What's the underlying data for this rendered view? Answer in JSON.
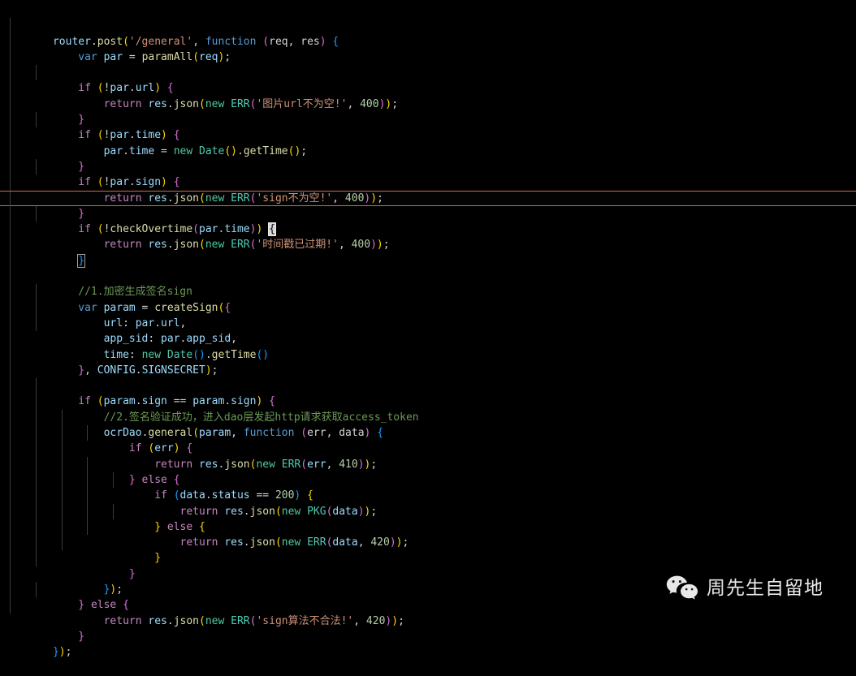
{
  "editor": {
    "language": "javascript",
    "theme": "dark-plus",
    "background": "#000000",
    "current_line_border_color": "#c8704a",
    "indent_guide_color": "#3b3b3b",
    "cursor_line_index": 12,
    "cursor_column_text": "{",
    "matching_bracket_text": "}",
    "matching_bracket_line_index": 14,
    "colors": {
      "keyword": "#c586c0",
      "keyword_blue": "#569cd6",
      "variable": "#9cdcfe",
      "function": "#dcdcaa",
      "type": "#4ec9b0",
      "string": "#ce9178",
      "number": "#b5cea8",
      "comment": "#6a9955",
      "plain": "#d4d4d4",
      "bracket_1": "#ffd700",
      "bracket_2": "#da70d6",
      "bracket_3": "#179fff"
    }
  },
  "code": {
    "lines": [
      "router.post('/general', function (req, res) {",
      "    var par = paramAll(req);",
      "",
      "    if (!par.url) {",
      "        return res.json(new ERR('图片url不为空!', 400));",
      "    }",
      "    if (!par.time) {",
      "        par.time = new Date().getTime();",
      "    }",
      "    if (!par.sign) {",
      "        return res.json(new ERR('sign不为空!', 400));",
      "    }",
      "    if (!checkOvertime(par.time)) {",
      "        return res.json(new ERR('时间戳已过期!', 400));",
      "    }",
      "",
      "    //1.加密生成签名sign",
      "    var param = createSign({",
      "        url: par.url,",
      "        app_sid: par.app_sid,",
      "        time: new Date().getTime()",
      "    }, CONFIG.SIGNSECRET);",
      "",
      "    if (param.sign == param.sign) {",
      "        //2.签名验证成功，进入dao层发起http请求获取access_token",
      "        ocrDao.general(param, function (err, data) {",
      "            if (err) {",
      "                return res.json(new ERR(err, 410));",
      "            } else {",
      "                if (data.status == 200) {",
      "                    return res.json(new PKG(data));",
      "                } else {",
      "                    return res.json(new ERR(data, 420));",
      "                }",
      "            }",
      "        });",
      "    } else {",
      "        return res.json(new ERR('sign算法不合法!', 420));",
      "    }",
      "});"
    ],
    "strings": [
      "'/general'",
      "'图片url不为空!'",
      "'sign不为空!'",
      "'时间戳已过期!'",
      "'sign算法不合法!'"
    ],
    "comments": [
      "//1.加密生成签名sign",
      "//2.签名验证成功，进入dao层发起http请求获取access_token"
    ],
    "numbers": [
      "400",
      "400",
      "400",
      "410",
      "200",
      "420",
      "420"
    ],
    "identifiers": [
      "router",
      "post",
      "function",
      "req",
      "res",
      "var",
      "par",
      "paramAll",
      "url",
      "time",
      "sign",
      "Date",
      "getTime",
      "checkOvertime",
      "ERR",
      "param",
      "createSign",
      "app_sid",
      "CONFIG",
      "SIGNSECRET",
      "ocrDao",
      "general",
      "err",
      "data",
      "status",
      "PKG",
      "json"
    ]
  },
  "watermark": {
    "icon": "wechat-icon",
    "label": "周先生自留地",
    "text_color": "#f2f2f2"
  }
}
